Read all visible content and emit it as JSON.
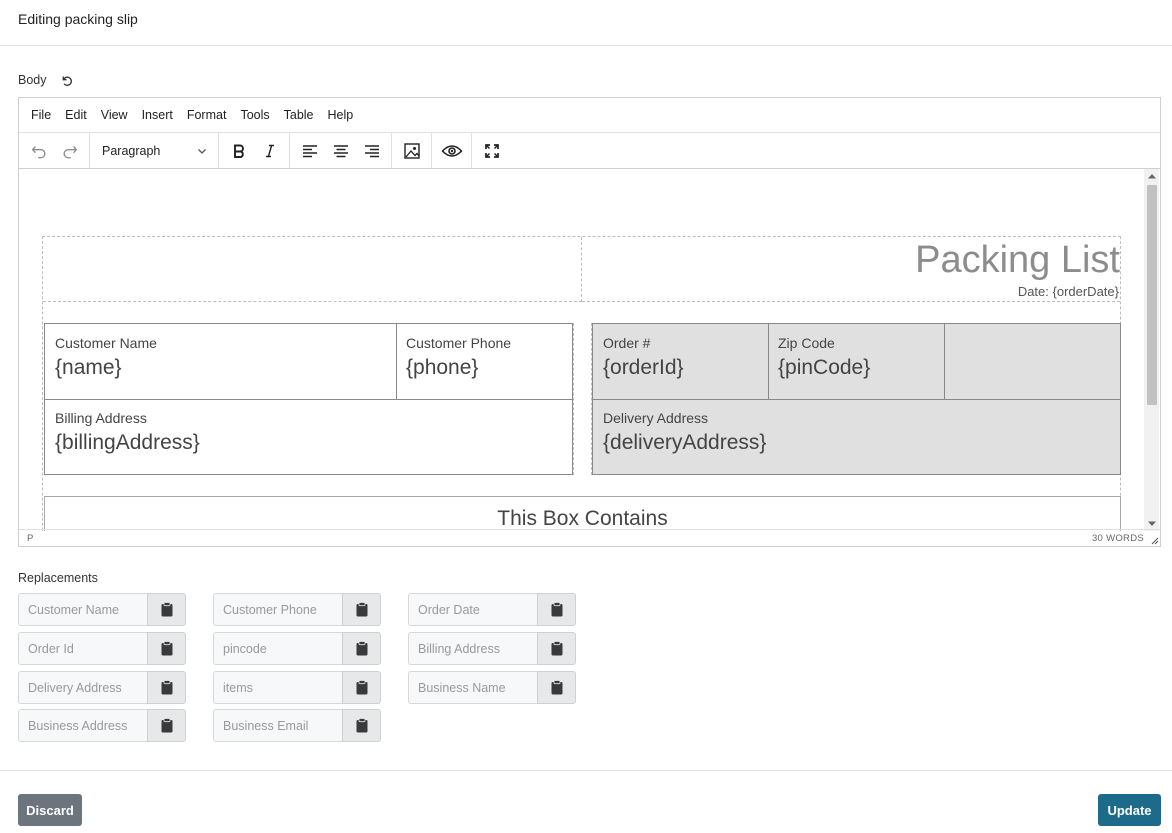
{
  "header": {
    "title": "Editing packing slip"
  },
  "body_section": {
    "label": "Body",
    "reset_icon": "undo-arrow-icon"
  },
  "editor": {
    "menu": [
      "File",
      "Edit",
      "View",
      "Insert",
      "Format",
      "Tools",
      "Table",
      "Help"
    ],
    "toolbar": {
      "undo_icon": "undo-icon",
      "redo_icon": "redo-icon",
      "block_format": "Paragraph",
      "bold_icon": "bold-icon",
      "italic_icon": "italic-icon",
      "align_left_icon": "align-left-icon",
      "align_center_icon": "align-center-icon",
      "align_right_icon": "align-right-icon",
      "image_icon": "image-icon",
      "preview_icon": "eye-icon",
      "fullscreen_icon": "fullscreen-icon"
    },
    "status": {
      "path": "P",
      "word_count": "30 WORDS"
    },
    "document": {
      "title": "Packing List",
      "date": "Date: {orderDate}",
      "customer_table": {
        "name_label": "Customer Name",
        "name_value": "{name}",
        "phone_label": "Customer Phone",
        "phone_value": "{phone}",
        "billing_label": "Billing Address",
        "billing_value": "{billingAddress}"
      },
      "order_table": {
        "order_label": "Order #",
        "order_value": "{orderId}",
        "zip_label": "Zip Code",
        "zip_value": "{pinCode}",
        "delivery_label": "Delivery Address",
        "delivery_value": "{deliveryAddress}"
      },
      "box_title": "This Box Contains"
    }
  },
  "replacements": {
    "label": "Replacements",
    "copy_icon": "clipboard-icon",
    "items": [
      "Customer Name",
      "Customer Phone",
      "Order Date",
      "Order Id",
      "pincode",
      "Billing Address",
      "Delivery Address",
      "items",
      "Business Name",
      "Business Address",
      "Business Email"
    ]
  },
  "footer": {
    "discard_label": "Discard",
    "update_label": "Update"
  },
  "colors": {
    "update_button": "#1d6b8a",
    "discard_button": "#6c757d",
    "order_table_bg": "#e0e0e0"
  }
}
